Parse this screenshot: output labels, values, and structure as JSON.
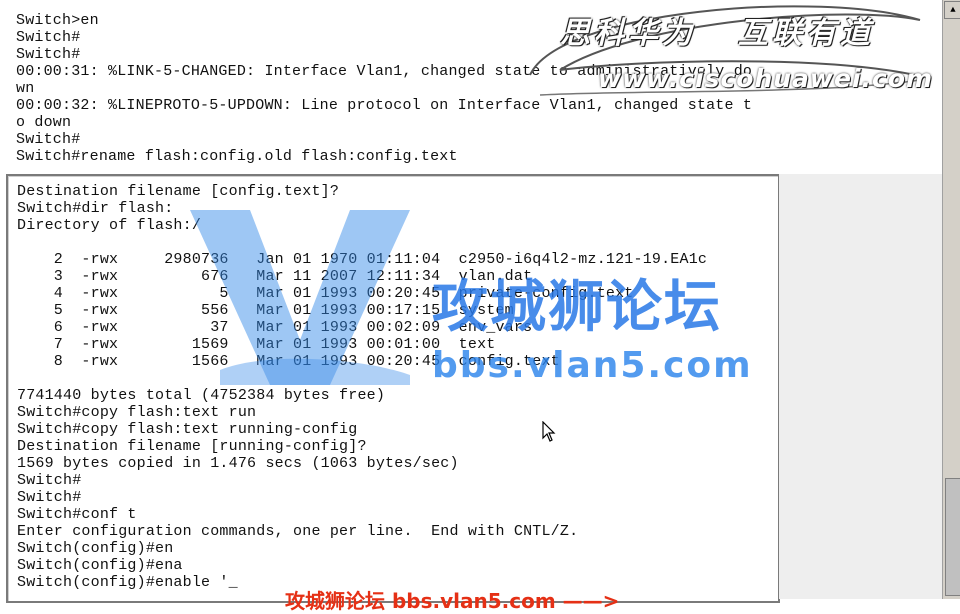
{
  "top_console_lines": [
    "Switch>en",
    "Switch#",
    "Switch#",
    "00:00:31: %LINK-5-CHANGED: Interface Vlan1, changed state to administratively do",
    "wn",
    "00:00:32: %LINEPROTO-5-UPDOWN: Line protocol on Interface Vlan1, changed state t",
    "o down",
    "Switch#",
    "Switch#rename flash:config.old flash:config.text"
  ],
  "terminal_lines": [
    "Destination filename [config.text]?",
    "Switch#dir flash:",
    "Directory of flash:/",
    "",
    "    2  -rwx     2980736   Jan 01 1970 01:11:04  c2950-i6q4l2-mz.121-19.EA1c",
    "    3  -rwx         676   Mar 11 2007 12:11:34  vlan.dat",
    "    4  -rwx           5   Mar 01 1993 00:20:45  private-config.text",
    "    5  -rwx         556   Mar 01 1993 00:17:15  system",
    "    6  -rwx          37   Mar 01 1993 00:02:09  env_vars",
    "    7  -rwx        1569   Mar 01 1993 00:01:00  text",
    "    8  -rwx        1566   Mar 01 1993 00:20:45  config.text",
    "",
    "7741440 bytes total (4752384 bytes free)",
    "Switch#copy flash:text run",
    "Switch#copy flash:text running-config",
    "Destination filename [running-config]?",
    "1569 bytes copied in 1.476 secs (1063 bytes/sec)",
    "Switch#",
    "Switch#",
    "Switch#conf t",
    "Enter configuration commands, one per line.  End with CNTL/Z.",
    "Switch(config)#en",
    "Switch(config)#ena",
    "Switch(config)#enable '_"
  ],
  "logo": {
    "cn_part1": "思科华为",
    "cn_part2": "互联有道",
    "url": "www.ciscohuawei.com"
  },
  "watermark": {
    "title": "攻城狮论坛",
    "url": "bbs.vlan5.com",
    "color": "#2f86e8"
  },
  "caption": {
    "text": "攻城狮论坛 bbs.vlan5.com ——>",
    "color": "#e53015"
  },
  "icons": {
    "cursor": "mouse-pointer-icon",
    "scroll_up": "arrow-up-icon",
    "scroll_down": "arrow-down-icon"
  }
}
